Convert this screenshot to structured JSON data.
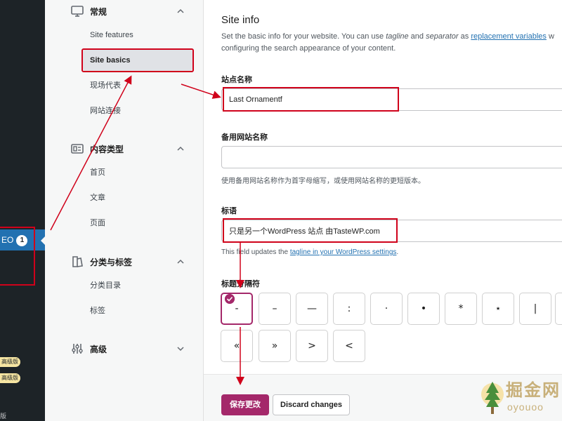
{
  "admin_sidebar": {
    "seo_label": "EO",
    "seo_badge": "1",
    "premium_badges": [
      "高级版",
      "高级版"
    ],
    "bottom_text": "版"
  },
  "settings_nav": {
    "groups": [
      {
        "label": "常规",
        "icon": "monitor-icon",
        "items": [
          "Site features",
          "Site basics",
          "现场代表",
          "网站连接"
        ]
      },
      {
        "label": "内容类型",
        "icon": "content-type-icon",
        "items": [
          "首页",
          "文章",
          "页面"
        ]
      },
      {
        "label": "分类与标签",
        "icon": "taxonomy-icon",
        "items": [
          "分类目录",
          "标签"
        ]
      },
      {
        "label": "高级",
        "icon": "sliders-icon",
        "items": []
      }
    ],
    "active_item": "Site basics"
  },
  "main": {
    "title": "Site info",
    "desc_part1": "Set the basic info for your website. You can use ",
    "desc_tagline": "tagline",
    "desc_and": " and ",
    "desc_separator": "separator",
    "desc_as": " as ",
    "desc_link": "replacement variables",
    "desc_w": " w",
    "desc_line2": "configuring the search appearance of your content.",
    "site_name_label": "站点名称",
    "site_name_value": "Last Ornamentf",
    "alt_name_label": "备用网站名称",
    "alt_name_value": "",
    "alt_name_help": "使用备用网站名称作为首字母缩写，或使用网站名称的更短版本。",
    "tagline_label": "标语",
    "tagline_value": "只是另一个WordPress 站点 由TasteWP.com",
    "tagline_help_prefix": "This field updates the ",
    "tagline_help_link": "tagline in your WordPress settings",
    "tagline_help_suffix": ".",
    "separator_label": "标题分隔符",
    "separators": [
      "-",
      "–",
      "—",
      ":",
      "·",
      "•",
      "*",
      "⋆",
      "|",
      "~",
      "«",
      "»",
      ">",
      "<"
    ],
    "selected_separator": "-",
    "save_label": "保存更改",
    "discard_label": "Discard changes"
  },
  "watermark": {
    "text": "掘金网",
    "sub": "oyouoo"
  },
  "colors": {
    "accent": "#a4286a",
    "link": "#2271b1",
    "annotation": "#d0021b",
    "sidebar_dark": "#1d2327"
  }
}
